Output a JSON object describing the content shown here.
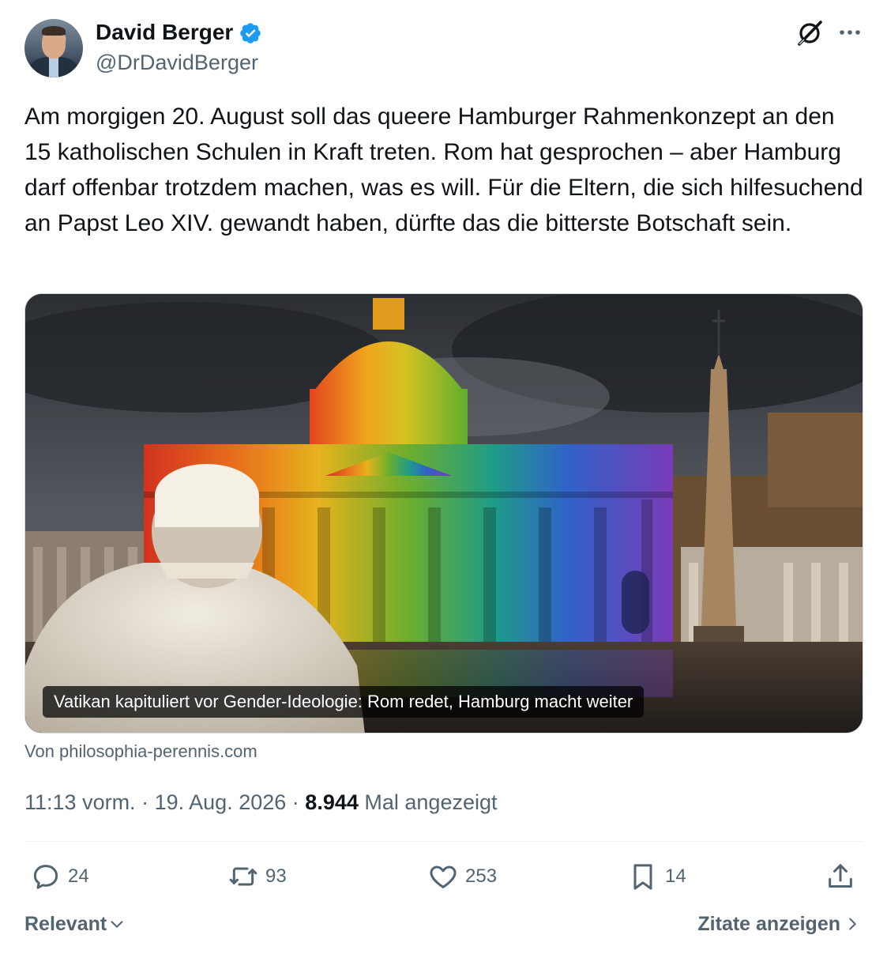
{
  "author": {
    "name": "David Berger",
    "handle": "@DrDavidBerger",
    "verified": true,
    "verified_color": "#1d9bf0"
  },
  "header_icons": [
    "grok-icon",
    "more-icon"
  ],
  "tweet": {
    "text": "Am morgigen 20. August soll das queere Hamburger Rahmenkonzept an den 15 katholischen Schulen in Kraft treten. Rom hat gesprochen – aber Hamburg darf offenbar trotzdem machen, was es will. Für die Eltern, die sich hilfesuchend an Papst Leo XIV. gewandt haben, dürfte das die bitterste Botschaft sein."
  },
  "link_card": {
    "caption": "Vatikan kapituliert vor Gender-Ideologie: Rom redet, Hamburg macht weiter",
    "source": "Von philosophia-perennis.com"
  },
  "meta": {
    "time": "11:13 vorm.",
    "separator": "·",
    "date": "19. Aug. 2026",
    "views_count": "8.944",
    "views_label": "Mal angezeigt"
  },
  "actions": {
    "reply": {
      "icon": "reply-icon",
      "count": "24"
    },
    "repost": {
      "icon": "repost-icon",
      "count": "93"
    },
    "like": {
      "icon": "like-icon",
      "count": "253"
    },
    "bookmark": {
      "icon": "bookmark-icon",
      "count": "14"
    },
    "share": {
      "icon": "share-icon"
    }
  },
  "footer": {
    "sort_label": "Relevant",
    "quotes_label": "Zitate anzeigen"
  },
  "colors": {
    "text_primary": "#0f1419",
    "text_secondary": "#536471",
    "border": "#cfd9de"
  }
}
